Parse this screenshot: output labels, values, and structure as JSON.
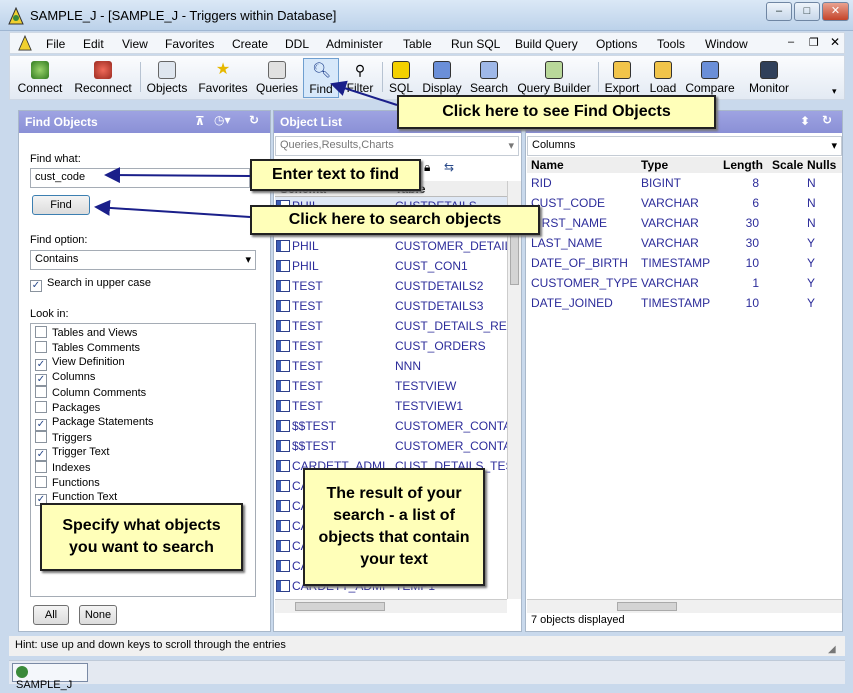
{
  "window": {
    "title": "SAMPLE_J - [SAMPLE_J - Triggers within Database]",
    "minimize": "–",
    "maximize": "□",
    "close": "✕"
  },
  "menu": [
    "File",
    "Edit",
    "View",
    "Favorites",
    "Create",
    "DDL",
    "Administer",
    "Table",
    "Run SQL",
    "Build Query",
    "Options",
    "Tools",
    "Window"
  ],
  "toolbar": [
    "Connect",
    "Reconnect",
    "Objects",
    "Favorites",
    "Queries",
    "Find",
    "Filter",
    "SQL",
    "Display",
    "Search",
    "Query Builder",
    "Export",
    "Load",
    "Compare",
    "Monitor"
  ],
  "find_panel": {
    "title": "Find Objects",
    "find_what_label": "Find what:",
    "find_what_value": "cust_code",
    "find_button": "Find",
    "find_option_label": "Find option:",
    "find_option_value": "Contains",
    "upper_case_label": "Search in upper case",
    "upper_case_checked": true,
    "look_in_label": "Look in:",
    "look_in": [
      {
        "label": "Tables and Views",
        "checked": false
      },
      {
        "label": "Tables Comments",
        "checked": false
      },
      {
        "label": "View Definition",
        "checked": true
      },
      {
        "label": "Columns",
        "checked": true
      },
      {
        "label": "Column Comments",
        "checked": false
      },
      {
        "label": "Packages",
        "checked": false
      },
      {
        "label": "Package Statements",
        "checked": true
      },
      {
        "label": "Triggers",
        "checked": false
      },
      {
        "label": "Trigger Text",
        "checked": true
      },
      {
        "label": "Indexes",
        "checked": false
      },
      {
        "label": "Functions",
        "checked": false
      },
      {
        "label": "Function Text",
        "checked": true
      }
    ],
    "all_button": "All",
    "none_button": "None"
  },
  "object_list": {
    "title": "Object List",
    "filter": "Queries,Results,Charts",
    "col_schema": "Schema",
    "col_table": "Table",
    "rows": [
      {
        "schema": "PHIL",
        "table": "CUSTDETAILS"
      },
      {
        "schema": "PHIL",
        "table": "CUSTDETAILS1"
      },
      {
        "schema": "PHIL",
        "table": "CUSTOMER_DETAILS"
      },
      {
        "schema": "PHIL",
        "table": "CUST_CON1"
      },
      {
        "schema": "TEST",
        "table": "CUSTDETAILS2"
      },
      {
        "schema": "TEST",
        "table": "CUSTDETAILS3"
      },
      {
        "schema": "TEST",
        "table": "CUST_DETAILS_REL"
      },
      {
        "schema": "TEST",
        "table": "CUST_ORDERS"
      },
      {
        "schema": "TEST",
        "table": "NNN"
      },
      {
        "schema": "TEST",
        "table": "TESTVIEW"
      },
      {
        "schema": "TEST",
        "table": "TESTVIEW1"
      },
      {
        "schema": "$$TEST",
        "table": "CUSTOMER_CONTA"
      },
      {
        "schema": "$$TEST",
        "table": "CUSTOMER_CONTA"
      },
      {
        "schema": "CARDETT_ADMIN",
        "table": "CUST_DETAILS_TEST"
      },
      {
        "schema": "CA",
        "table": "TEST"
      },
      {
        "schema": "CA",
        "table": ""
      },
      {
        "schema": "CA",
        "table": ""
      },
      {
        "schema": "CA",
        "table": ""
      },
      {
        "schema": "CA",
        "table": ""
      },
      {
        "schema": "CARDETT_ADMIN",
        "table": "TEMP1"
      }
    ]
  },
  "columns_panel": {
    "selector": "Columns",
    "headers": [
      "Name",
      "Type",
      "Length",
      "Scale",
      "Nulls"
    ],
    "rows": [
      {
        "name": "RID",
        "type": "BIGINT",
        "length": "8",
        "scale": "",
        "nulls": "N"
      },
      {
        "name": "CUST_CODE",
        "type": "VARCHAR",
        "length": "6",
        "scale": "",
        "nulls": "N"
      },
      {
        "name": "FIRST_NAME",
        "type": "VARCHAR",
        "length": "30",
        "scale": "",
        "nulls": "N"
      },
      {
        "name": "LAST_NAME",
        "type": "VARCHAR",
        "length": "30",
        "scale": "",
        "nulls": "Y"
      },
      {
        "name": "DATE_OF_BIRTH",
        "type": "TIMESTAMP",
        "length": "10",
        "scale": "",
        "nulls": "Y"
      },
      {
        "name": "CUSTOMER_TYPE",
        "type": "VARCHAR",
        "length": "1",
        "scale": "",
        "nulls": "Y"
      },
      {
        "name": "DATE_JOINED",
        "type": "TIMESTAMP",
        "length": "10",
        "scale": "",
        "nulls": "Y"
      }
    ],
    "count": "7 objects displayed"
  },
  "callouts": {
    "find_objects": "Click here to see Find Objects",
    "enter_text": "Enter text to find",
    "search_objects": "Click here to search objects",
    "specify": "Specify what objects you want to search",
    "result": "The result of your search - a list of objects that contain your text"
  },
  "status": {
    "hint": "Hint: use up and down keys to scroll through the entries"
  },
  "taskbar": {
    "item": "SAMPLE_J"
  }
}
